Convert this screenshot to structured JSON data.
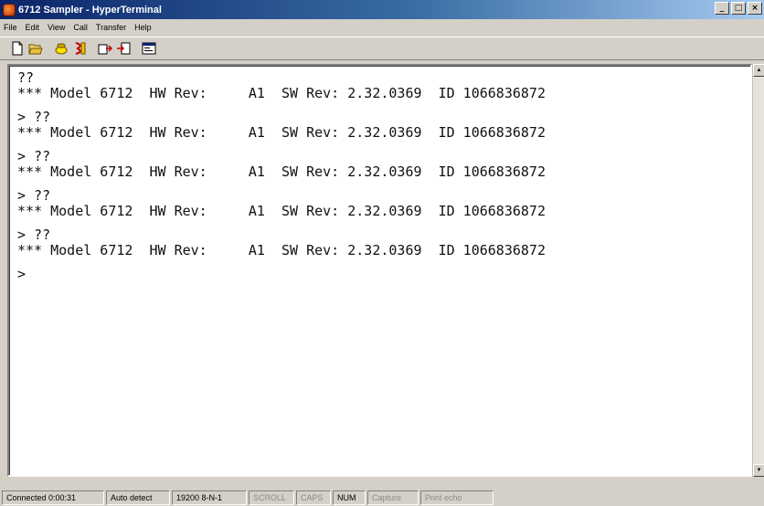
{
  "window": {
    "title": "6712 Sampler - HyperTerminal",
    "controls": {
      "minimize": "_",
      "maximize": "□",
      "close": "×"
    }
  },
  "menu": {
    "items": [
      {
        "label": "File"
      },
      {
        "label": "Edit"
      },
      {
        "label": "View"
      },
      {
        "label": "Call"
      },
      {
        "label": "Transfer"
      },
      {
        "label": "Help"
      }
    ]
  },
  "toolbar": {
    "buttons": [
      {
        "icon": "new-connection-icon"
      },
      {
        "icon": "open-icon"
      },
      {
        "icon": "connect-icon"
      },
      {
        "icon": "disconnect-icon"
      },
      {
        "icon": "send-icon"
      },
      {
        "icon": "receive-icon"
      },
      {
        "icon": "properties-icon"
      }
    ]
  },
  "terminal": {
    "lines": [
      "??",
      "*** Model 6712  HW Rev:     A1  SW Rev: 2.32.0369  ID 1066836872",
      "",
      "> ??",
      "*** Model 6712  HW Rev:     A1  SW Rev: 2.32.0369  ID 1066836872",
      "",
      "> ??",
      "*** Model 6712  HW Rev:     A1  SW Rev: 2.32.0369  ID 1066836872",
      "",
      "> ??",
      "*** Model 6712  HW Rev:     A1  SW Rev: 2.32.0369  ID 1066836872",
      "",
      "> ??",
      "*** Model 6712  HW Rev:     A1  SW Rev: 2.32.0369  ID 1066836872",
      "",
      ">"
    ]
  },
  "status": {
    "connected": "Connected 0:00:31",
    "detect": "Auto detect",
    "settings": "19200 8-N-1",
    "scroll": "SCROLL",
    "caps": "CAPS",
    "num": "NUM",
    "capture": "Capture",
    "print_echo": "Print echo"
  }
}
